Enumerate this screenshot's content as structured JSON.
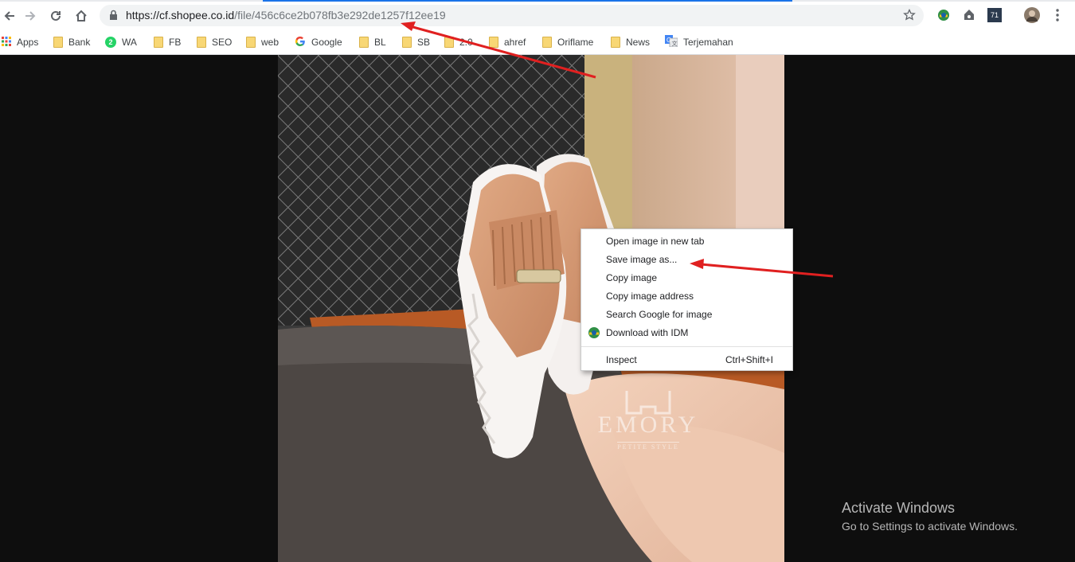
{
  "browser": {
    "url_host": "https://cf.shopee.co.id",
    "url_path": "/file/456c6ce2b078fb3e292de1257f12ee19",
    "ext_badge": "71",
    "accent_color": "#1a73e8"
  },
  "bookmarks": [
    {
      "label": "Apps",
      "icon": "apps-grid-icon"
    },
    {
      "label": "Bank",
      "icon": "folder-icon"
    },
    {
      "label": "WA",
      "icon": "whatsapp-icon"
    },
    {
      "label": "FB",
      "icon": "folder-icon"
    },
    {
      "label": "SEO",
      "icon": "folder-icon"
    },
    {
      "label": "web",
      "icon": "folder-icon"
    },
    {
      "label": "Google",
      "icon": "google-icon"
    },
    {
      "label": "BL",
      "icon": "folder-icon"
    },
    {
      "label": "SB",
      "icon": "folder-icon"
    },
    {
      "label": "2.0",
      "icon": "folder-icon"
    },
    {
      "label": "ahref",
      "icon": "folder-icon"
    },
    {
      "label": "Oriflame",
      "icon": "folder-icon"
    },
    {
      "label": "News",
      "icon": "folder-icon"
    },
    {
      "label": "Terjemahan",
      "icon": "google-translate-icon"
    }
  ],
  "whatsapp_badge": "2",
  "image": {
    "watermark_brand": "EMORY",
    "watermark_tagline": "PETITE STYLE"
  },
  "context_menu": {
    "items": [
      {
        "label": "Open image in new tab"
      },
      {
        "label": "Save image as..."
      },
      {
        "label": "Copy image"
      },
      {
        "label": "Copy image address"
      },
      {
        "label": "Search Google for image"
      },
      {
        "label": "Download with IDM",
        "icon": "idm-icon"
      }
    ],
    "inspect": {
      "label": "Inspect",
      "shortcut": "Ctrl+Shift+I"
    }
  },
  "activation": {
    "title": "Activate Windows",
    "subtitle": "Go to Settings to activate Windows."
  },
  "annotation_color": "#e02020"
}
